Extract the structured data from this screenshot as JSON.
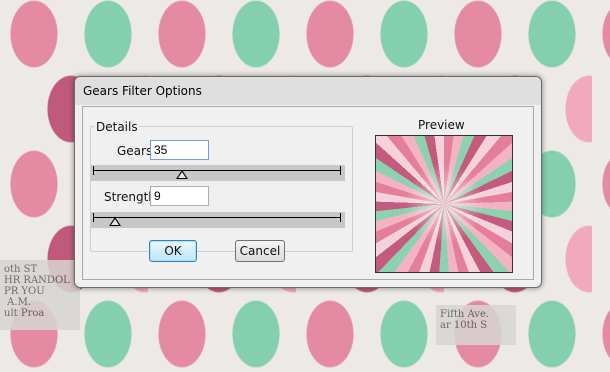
{
  "background": {
    "newsprint_left": "oth ST\nHR RANDOL\nPR YOU\n A.M.\nult Proa",
    "newsprint_right": "Fifth Ave.\nar 10th S"
  },
  "dialog": {
    "title": "Gears Filter Options",
    "details_label": "Details",
    "gears_label": "Gears",
    "gears_value": "35",
    "gears_slider_fraction": 0.36,
    "strength_label": "Strength",
    "strength_value": "9",
    "strength_slider_fraction": 0.09,
    "ok_label": "OK",
    "cancel_label": "Cancel",
    "preview_label": "Preview"
  },
  "colors": {
    "pink": "#e58aa3",
    "mint": "#84d0ae",
    "raspberry": "#c05a7d"
  }
}
